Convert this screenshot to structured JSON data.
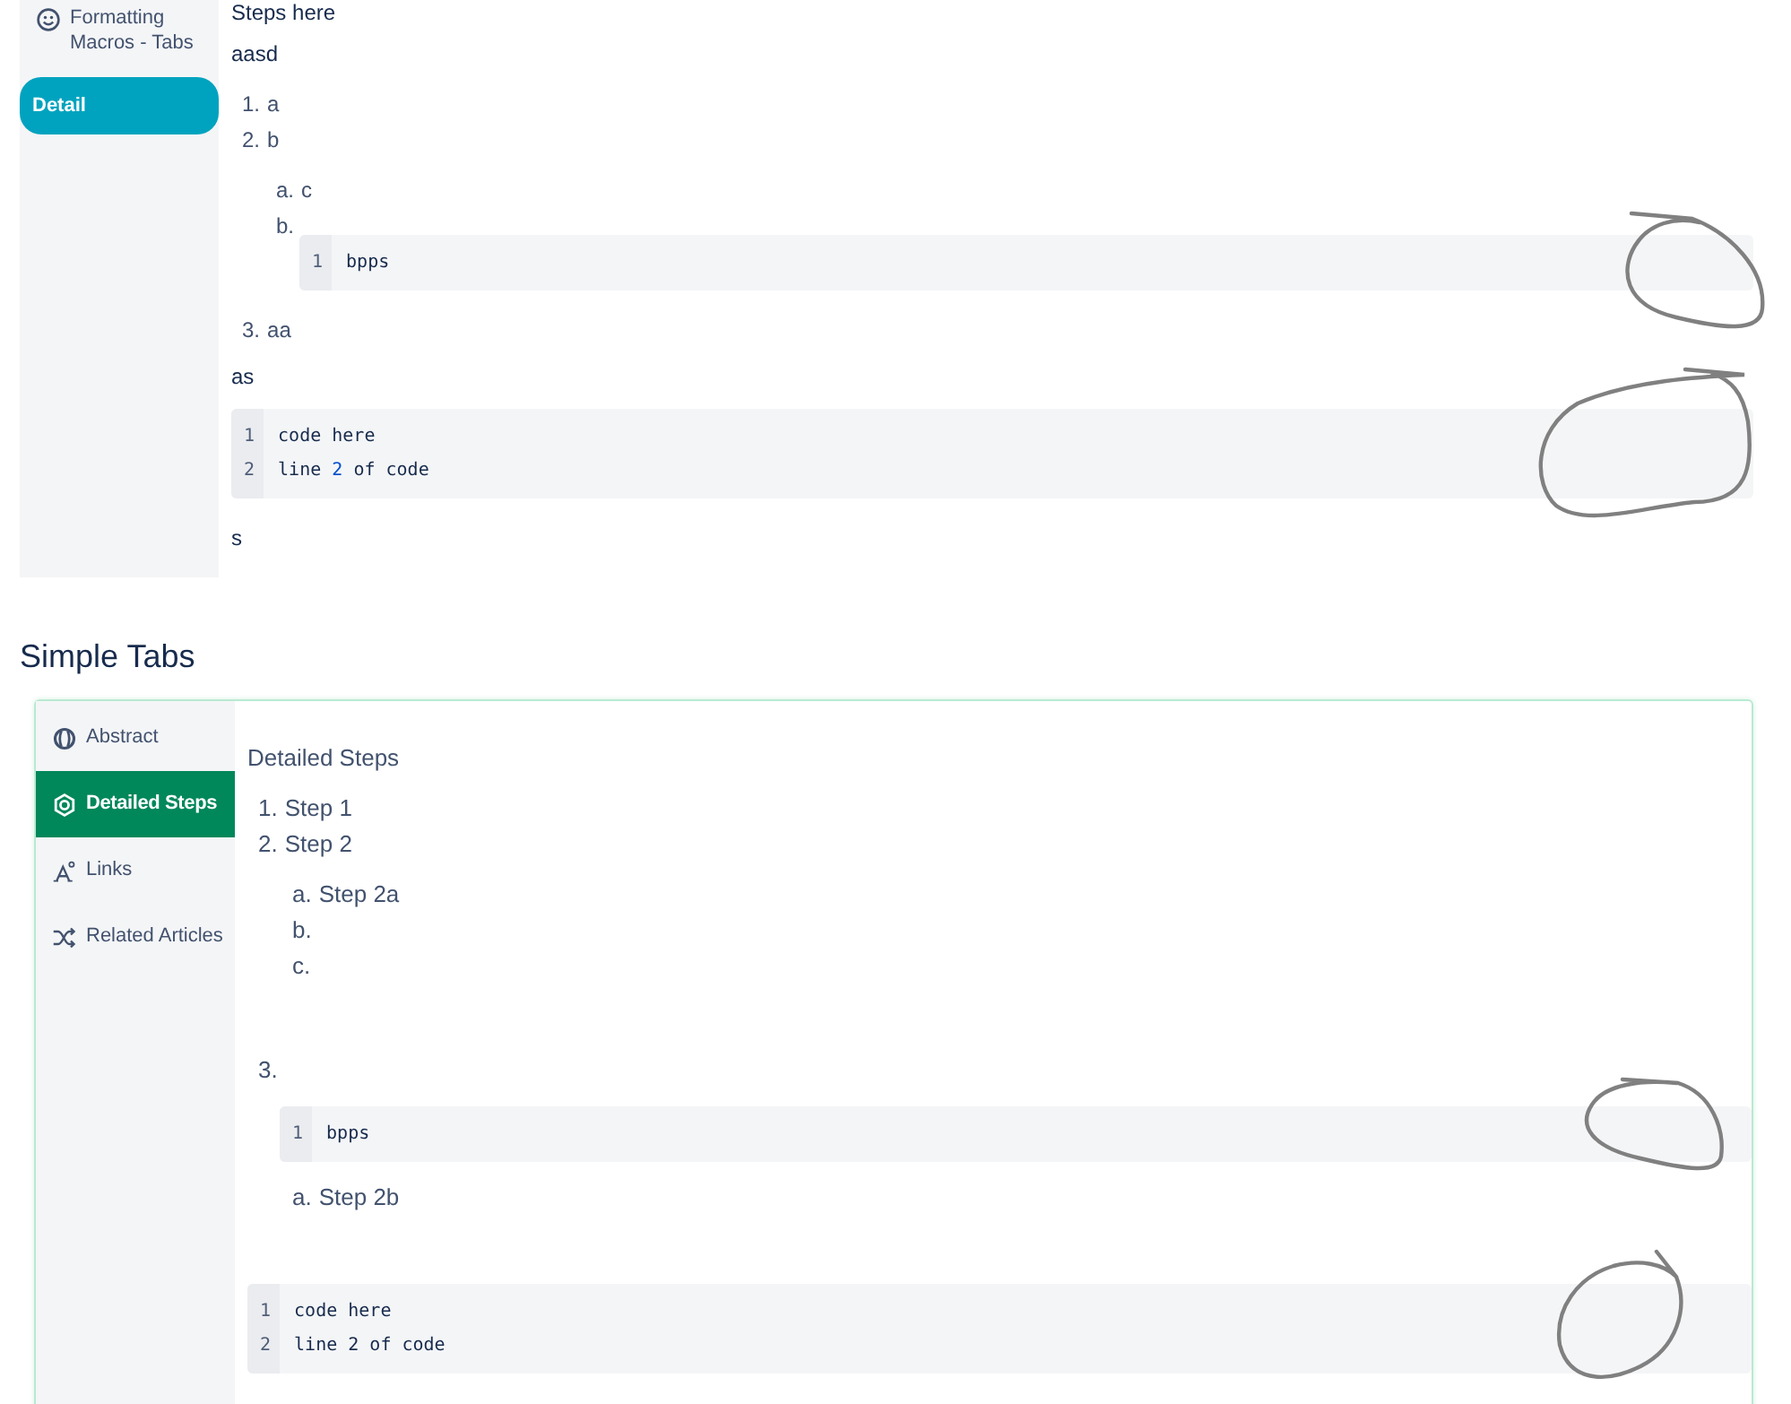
{
  "top_panel": {
    "tabs": [
      {
        "label": "Formatting Macros - Tabs",
        "selected": false
      },
      {
        "label": "Detail",
        "selected": true
      }
    ],
    "content": [
      {
        "kind": "paragraph",
        "text": "Steps here"
      },
      {
        "kind": "paragraph",
        "text": "aasd"
      },
      {
        "kind": "list",
        "items": [
          {
            "marker": "1.",
            "text": "a"
          },
          {
            "marker": "2.",
            "text": "b",
            "blocks": [
              {
                "kind": "list",
                "items": [
                  {
                    "marker": "a.",
                    "text": "c"
                  },
                  {
                    "marker": "b.",
                    "blocks": [
                      {
                        "kind": "code",
                        "lines": [
                          {
                            "number": "1",
                            "tokens": [
                              {
                                "text": "bpps"
                              }
                            ]
                          }
                        ]
                      }
                    ]
                  }
                ]
              }
            ]
          },
          {
            "marker": "3.",
            "text": "aa"
          }
        ]
      },
      {
        "kind": "paragraph",
        "text": "as"
      },
      {
        "kind": "code",
        "lines": [
          {
            "number": "1",
            "tokens": [
              {
                "text": "code here"
              }
            ]
          },
          {
            "number": "2",
            "tokens": [
              {
                "text": "line "
              },
              {
                "text": "2",
                "kind": "number"
              },
              {
                "text": " of code"
              }
            ]
          }
        ]
      },
      {
        "kind": "paragraph",
        "text": "s"
      }
    ]
  },
  "simple_tabs": {
    "heading": "Simple Tabs",
    "tabs": [
      {
        "label": "Abstract",
        "selected": false
      },
      {
        "label": "Detailed Steps",
        "selected": true
      },
      {
        "label": "Links",
        "selected": false
      },
      {
        "label": "Related Articles",
        "selected": false
      }
    ],
    "content": [
      {
        "kind": "paragraph",
        "text": "Detailed Steps"
      },
      {
        "kind": "list",
        "items": [
          {
            "marker": "1.",
            "text": "Step 1"
          },
          {
            "marker": "2.",
            "text": "Step 2",
            "blocks": [
              {
                "kind": "list",
                "items": [
                  {
                    "marker": "a.",
                    "text": "Step 2a"
                  },
                  {
                    "marker": "b."
                  },
                  {
                    "marker": "c."
                  }
                ]
              }
            ]
          },
          {
            "marker": "3.",
            "blocks": [
              {
                "kind": "code",
                "lines": [
                  {
                    "number": "1",
                    "tokens": [
                      {
                        "text": "bpps"
                      }
                    ]
                  }
                ]
              },
              {
                "kind": "list",
                "items": [
                  {
                    "marker": "a.",
                    "text": "Step 2b"
                  }
                ]
              }
            ]
          }
        ]
      },
      {
        "kind": "code",
        "lines": [
          {
            "number": "1",
            "tokens": [
              {
                "text": "code here"
              }
            ]
          },
          {
            "number": "2",
            "tokens": [
              {
                "text": "line 2 of code"
              }
            ]
          }
        ]
      }
    ]
  }
}
